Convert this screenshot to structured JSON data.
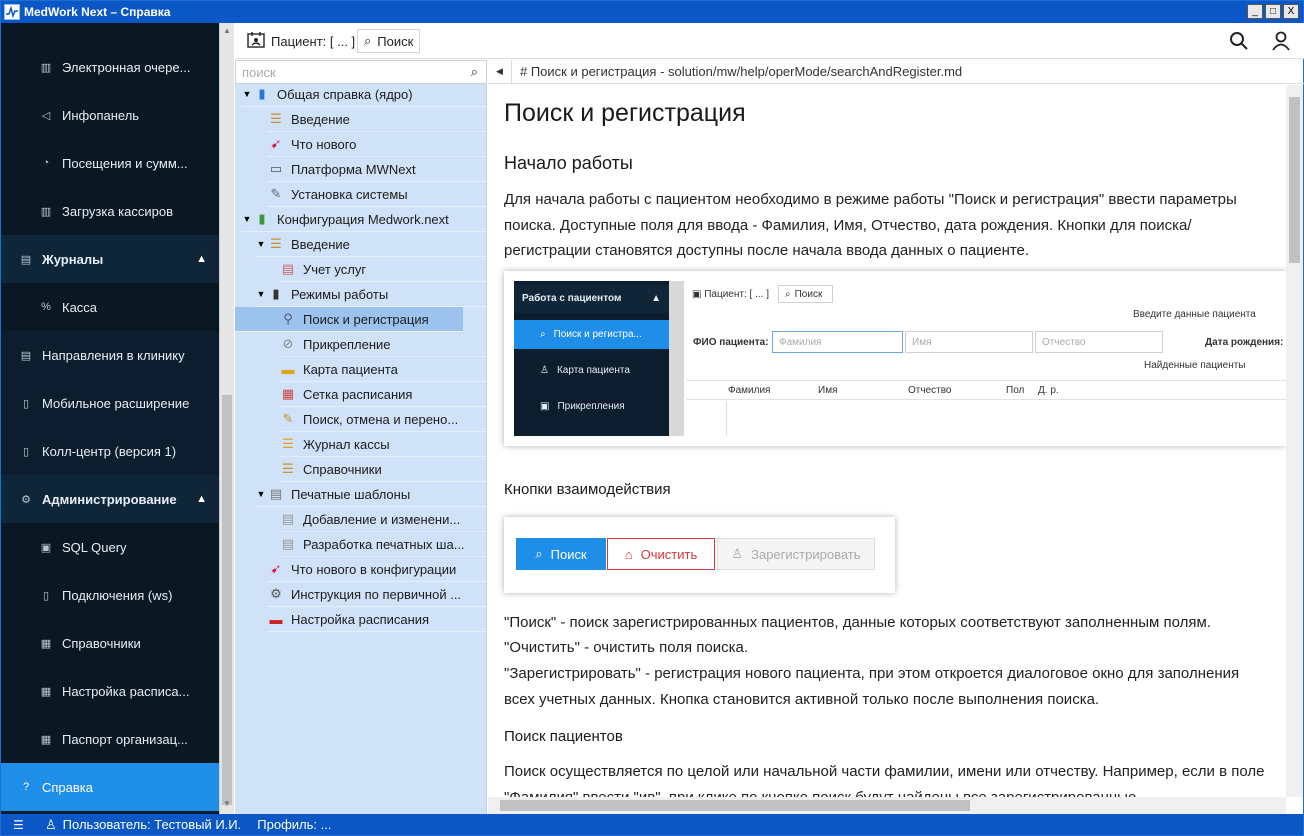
{
  "window": {
    "title": "MedWork Next – Справка",
    "controls": {
      "minimize": "_",
      "maximize": "□",
      "close": "X"
    }
  },
  "sidebar": {
    "items": [
      {
        "label": "Электронная очере...",
        "icon": "bar-chart-icon"
      },
      {
        "label": "Инфопанель",
        "icon": "megaphone-icon"
      },
      {
        "label": "Посещения и сумм...",
        "icon": "pie-chart-icon"
      },
      {
        "label": "Загрузка кассиров",
        "icon": "bar-chart-icon"
      },
      {
        "label": "Журналы",
        "icon": "journal-icon"
      },
      {
        "label": "Касса",
        "icon": "percent-icon"
      },
      {
        "label": "Направления в клинику",
        "icon": "document-icon"
      },
      {
        "label": "Мобильное расширение",
        "icon": "mobile-icon"
      },
      {
        "label": "Колл-центр (версия 1)",
        "icon": "mobile-icon"
      },
      {
        "label": "Администрирование",
        "icon": "gear-icon"
      },
      {
        "label": "SQL Query",
        "icon": "console-icon"
      },
      {
        "label": "Подключения (ws)",
        "icon": "document-icon"
      },
      {
        "label": "Справочники",
        "icon": "book-icon"
      },
      {
        "label": "Настройка расписа...",
        "icon": "calendar-icon"
      },
      {
        "label": "Паспорт организац...",
        "icon": "book-icon"
      },
      {
        "label": "Справка",
        "icon": "help-icon"
      }
    ]
  },
  "toolbar": {
    "patient_chip": "Пациент: [ ... ]",
    "search_chip": "Поиск"
  },
  "tree": {
    "search_placeholder": "поиск",
    "nodes": [
      {
        "label": "Общая справка (ядро)"
      },
      {
        "label": "Введение"
      },
      {
        "label": "Что нового"
      },
      {
        "label": "Платформа MWNext"
      },
      {
        "label": "Установка системы"
      },
      {
        "label": "Конфигурация Medwork.next"
      },
      {
        "label": "Введение"
      },
      {
        "label": "Учет услуг"
      },
      {
        "label": "Режимы работы"
      },
      {
        "label": "Поиск и регистрация"
      },
      {
        "label": "Прикрепление"
      },
      {
        "label": "Карта пациента"
      },
      {
        "label": "Сетка расписания"
      },
      {
        "label": "Поиск, отмена и перено..."
      },
      {
        "label": "Журнал кассы"
      },
      {
        "label": "Справочники"
      },
      {
        "label": "Печатные шаблоны"
      },
      {
        "label": "Добавление и изменени..."
      },
      {
        "label": "Разработка печатных ша..."
      },
      {
        "label": "Что нового в конфигурации"
      },
      {
        "label": "Инструкция по первичной ..."
      },
      {
        "label": "Настройка расписания"
      }
    ]
  },
  "content": {
    "path": "# Поиск и регистрация - solution/mw/help/operMode/searchAndRegister.md",
    "h1": "Поиск и регистрация",
    "h2_start": "Начало работы",
    "intro": "Для начала работы с пациентом необходимо в режиме работы \"Поиск и регистрация\" ввести параметры поиска. Доступные поля для ввода - Фамилия, Имя, Отчество, дата рождения. Кнопки для поиска/регистрации становятся доступны после начала ввода данных о пациенте.",
    "h3_buttons": "Кнопки взаимодействия",
    "desc_search": "\"Поиск\" - поиск зарегистрированных пациентов, данные которых соответствуют заполненным полям.",
    "desc_clear": "\"Очистить\" - очистить поля поиска.",
    "desc_register": "\"Зарегистрировать\" - регистрация нового пациента, при этом откроется диалоговое окно для заполнения всех учетных данных. Кнопка становится активной только после выполнения поиска.",
    "h3_search": "Поиск пациентов",
    "search_para": "Поиск осуществляется по целой или начальной части фамилии, имени или отчеству. Например, если в поле \"Фамилия\" ввести \"ив\", при клике по кнопке поиск будут найдены все зарегистрированные"
  },
  "shot1": {
    "side_header": "Работа с пациентом",
    "side_items": [
      "Поиск и регистра...",
      "Карта пациента",
      "Прикрепления"
    ],
    "patient_chip": "Пациент: [ ... ]",
    "search_chip": "Поиск",
    "enter_label": "Введите данные пациента",
    "fio_label": "ФИО пациента:",
    "ph_last": "Фамилия",
    "ph_first": "Имя",
    "ph_middle": "Отчество",
    "dob_label": "Дата рождения:",
    "found_label": "Найденные пациенты",
    "cols": [
      "Фамилия",
      "Имя",
      "Отчество",
      "Пол",
      "Д. р."
    ]
  },
  "shot2": {
    "search": "Поиск",
    "clear": "Очистить",
    "register": "Зарегистрировать"
  },
  "status": {
    "user": "Пользователь: Тестовый И.И.",
    "profile": "Профиль: ..."
  },
  "colors": {
    "titlebar": "#0a57c5",
    "sidebar_bg": "#0c1e2d",
    "sidebar_active": "#1e8ee8",
    "tree_bg": "#cfe2f8",
    "tree_selected": "#9cc3ee",
    "clear_button": "#d9363e"
  }
}
